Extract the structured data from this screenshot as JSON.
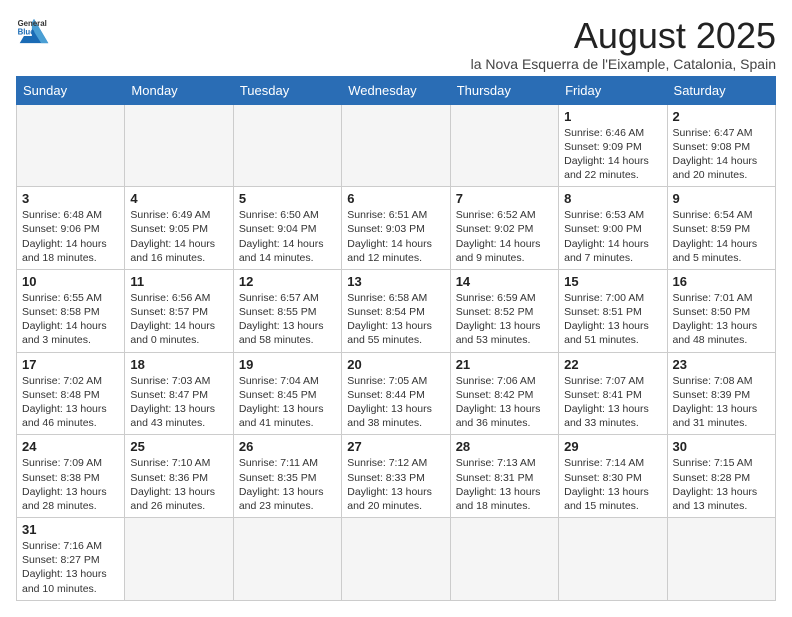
{
  "logo": {
    "text_general": "General",
    "text_blue": "Blue"
  },
  "header": {
    "title": "August 2025",
    "subtitle": "la Nova Esquerra de l'Eixample, Catalonia, Spain"
  },
  "days_of_week": [
    "Sunday",
    "Monday",
    "Tuesday",
    "Wednesday",
    "Thursday",
    "Friday",
    "Saturday"
  ],
  "weeks": [
    [
      {
        "day": "",
        "info": "",
        "empty": true
      },
      {
        "day": "",
        "info": "",
        "empty": true
      },
      {
        "day": "",
        "info": "",
        "empty": true
      },
      {
        "day": "",
        "info": "",
        "empty": true
      },
      {
        "day": "",
        "info": "",
        "empty": true
      },
      {
        "day": "1",
        "info": "Sunrise: 6:46 AM\nSunset: 9:09 PM\nDaylight: 14 hours\nand 22 minutes."
      },
      {
        "day": "2",
        "info": "Sunrise: 6:47 AM\nSunset: 9:08 PM\nDaylight: 14 hours\nand 20 minutes."
      }
    ],
    [
      {
        "day": "3",
        "info": "Sunrise: 6:48 AM\nSunset: 9:06 PM\nDaylight: 14 hours\nand 18 minutes."
      },
      {
        "day": "4",
        "info": "Sunrise: 6:49 AM\nSunset: 9:05 PM\nDaylight: 14 hours\nand 16 minutes."
      },
      {
        "day": "5",
        "info": "Sunrise: 6:50 AM\nSunset: 9:04 PM\nDaylight: 14 hours\nand 14 minutes."
      },
      {
        "day": "6",
        "info": "Sunrise: 6:51 AM\nSunset: 9:03 PM\nDaylight: 14 hours\nand 12 minutes."
      },
      {
        "day": "7",
        "info": "Sunrise: 6:52 AM\nSunset: 9:02 PM\nDaylight: 14 hours\nand 9 minutes."
      },
      {
        "day": "8",
        "info": "Sunrise: 6:53 AM\nSunset: 9:00 PM\nDaylight: 14 hours\nand 7 minutes."
      },
      {
        "day": "9",
        "info": "Sunrise: 6:54 AM\nSunset: 8:59 PM\nDaylight: 14 hours\nand 5 minutes."
      }
    ],
    [
      {
        "day": "10",
        "info": "Sunrise: 6:55 AM\nSunset: 8:58 PM\nDaylight: 14 hours\nand 3 minutes."
      },
      {
        "day": "11",
        "info": "Sunrise: 6:56 AM\nSunset: 8:57 PM\nDaylight: 14 hours\nand 0 minutes."
      },
      {
        "day": "12",
        "info": "Sunrise: 6:57 AM\nSunset: 8:55 PM\nDaylight: 13 hours\nand 58 minutes."
      },
      {
        "day": "13",
        "info": "Sunrise: 6:58 AM\nSunset: 8:54 PM\nDaylight: 13 hours\nand 55 minutes."
      },
      {
        "day": "14",
        "info": "Sunrise: 6:59 AM\nSunset: 8:52 PM\nDaylight: 13 hours\nand 53 minutes."
      },
      {
        "day": "15",
        "info": "Sunrise: 7:00 AM\nSunset: 8:51 PM\nDaylight: 13 hours\nand 51 minutes."
      },
      {
        "day": "16",
        "info": "Sunrise: 7:01 AM\nSunset: 8:50 PM\nDaylight: 13 hours\nand 48 minutes."
      }
    ],
    [
      {
        "day": "17",
        "info": "Sunrise: 7:02 AM\nSunset: 8:48 PM\nDaylight: 13 hours\nand 46 minutes."
      },
      {
        "day": "18",
        "info": "Sunrise: 7:03 AM\nSunset: 8:47 PM\nDaylight: 13 hours\nand 43 minutes."
      },
      {
        "day": "19",
        "info": "Sunrise: 7:04 AM\nSunset: 8:45 PM\nDaylight: 13 hours\nand 41 minutes."
      },
      {
        "day": "20",
        "info": "Sunrise: 7:05 AM\nSunset: 8:44 PM\nDaylight: 13 hours\nand 38 minutes."
      },
      {
        "day": "21",
        "info": "Sunrise: 7:06 AM\nSunset: 8:42 PM\nDaylight: 13 hours\nand 36 minutes."
      },
      {
        "day": "22",
        "info": "Sunrise: 7:07 AM\nSunset: 8:41 PM\nDaylight: 13 hours\nand 33 minutes."
      },
      {
        "day": "23",
        "info": "Sunrise: 7:08 AM\nSunset: 8:39 PM\nDaylight: 13 hours\nand 31 minutes."
      }
    ],
    [
      {
        "day": "24",
        "info": "Sunrise: 7:09 AM\nSunset: 8:38 PM\nDaylight: 13 hours\nand 28 minutes."
      },
      {
        "day": "25",
        "info": "Sunrise: 7:10 AM\nSunset: 8:36 PM\nDaylight: 13 hours\nand 26 minutes."
      },
      {
        "day": "26",
        "info": "Sunrise: 7:11 AM\nSunset: 8:35 PM\nDaylight: 13 hours\nand 23 minutes."
      },
      {
        "day": "27",
        "info": "Sunrise: 7:12 AM\nSunset: 8:33 PM\nDaylight: 13 hours\nand 20 minutes."
      },
      {
        "day": "28",
        "info": "Sunrise: 7:13 AM\nSunset: 8:31 PM\nDaylight: 13 hours\nand 18 minutes."
      },
      {
        "day": "29",
        "info": "Sunrise: 7:14 AM\nSunset: 8:30 PM\nDaylight: 13 hours\nand 15 minutes."
      },
      {
        "day": "30",
        "info": "Sunrise: 7:15 AM\nSunset: 8:28 PM\nDaylight: 13 hours\nand 13 minutes."
      }
    ],
    [
      {
        "day": "31",
        "info": "Sunrise: 7:16 AM\nSunset: 8:27 PM\nDaylight: 13 hours\nand 10 minutes."
      },
      {
        "day": "",
        "info": "",
        "empty": true
      },
      {
        "day": "",
        "info": "",
        "empty": true
      },
      {
        "day": "",
        "info": "",
        "empty": true
      },
      {
        "day": "",
        "info": "",
        "empty": true
      },
      {
        "day": "",
        "info": "",
        "empty": true
      },
      {
        "day": "",
        "info": "",
        "empty": true
      }
    ]
  ],
  "colors": {
    "header_bg": "#2a6db5",
    "header_text": "#ffffff",
    "empty_cell": "#f5f5f5"
  }
}
